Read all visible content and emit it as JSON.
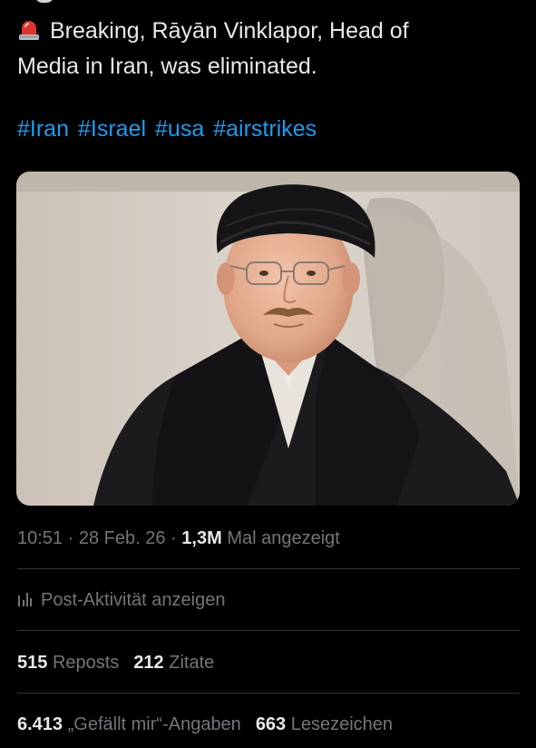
{
  "tweet": {
    "siren_emoji_icon": "police-car-light-icon",
    "text_line1": "Breaking, Rāyān Vinklapor, Head of",
    "text_line2": "Media in Iran, was eliminated.",
    "hashtags": [
      "#Iran",
      "#Israel",
      "#usa",
      "#airstrikes"
    ],
    "hashtag_color": "#1d9bf0"
  },
  "meta": {
    "time": "10:51",
    "separator": "·",
    "date": "28 Feb. 26",
    "views_count": "1,3M",
    "views_label": "Mal angezeigt"
  },
  "activity": {
    "icon": "bar-chart-icon",
    "label": "Post-Aktivität anzeigen"
  },
  "stats": {
    "reposts_count": "515",
    "reposts_label": "Reposts",
    "quotes_count": "212",
    "quotes_label": "Zitate",
    "likes_count": "6.413",
    "likes_label": "„Gefällt mir“-Angaben",
    "bookmarks_count": "663",
    "bookmarks_label": "Lesezeichen"
  },
  "colors": {
    "background": "#000000",
    "text_primary": "#e7e9ea",
    "text_secondary": "#71767b",
    "divider": "#2f3336"
  }
}
